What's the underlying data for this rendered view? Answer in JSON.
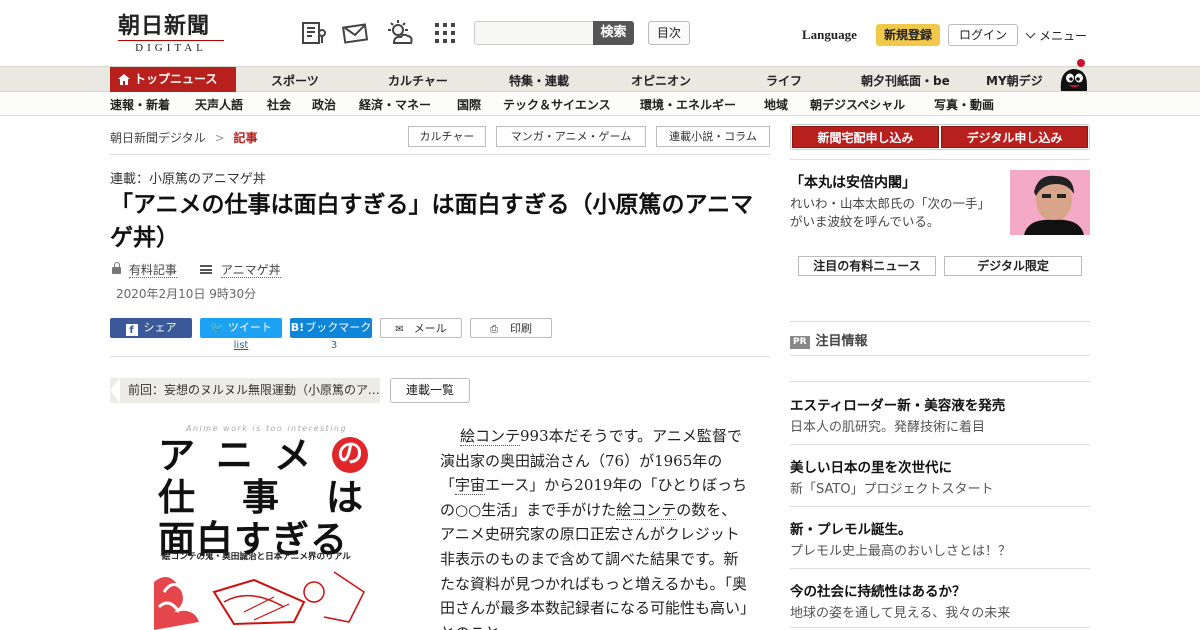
{
  "header": {
    "logo": {
      "main": "朝日新聞",
      "sub": "DIGITAL"
    },
    "icons": [
      "paper-icon",
      "mail-icon",
      "weather-icon",
      "grid-icon"
    ],
    "search": {
      "placeholder": "",
      "button": "検索"
    },
    "index_button": "目次",
    "language": "Language",
    "register": "新規登録",
    "login": "ログイン",
    "menu": "メニュー"
  },
  "nav_primary": [
    "トップニュース",
    "スポーツ",
    "カルチャー",
    "特集・連載",
    "オピニオン",
    "ライフ",
    "朝夕刊紙面・be",
    "MY朝デジ"
  ],
  "nav_secondary": [
    "速報・新着",
    "天声人語",
    "社会",
    "政治",
    "経済・マネー",
    "国際",
    "テック＆サイエンス",
    "環境・エネルギー",
    "地域",
    "朝デジスペシャル",
    "写真・動画"
  ],
  "breadcrumb": {
    "home": "朝日新聞デジタル",
    "sep": ">",
    "current": "記事"
  },
  "tags": [
    "カルチャー",
    "マンガ・アニメ・ゲーム",
    "連載小説・コラム"
  ],
  "article": {
    "series": "連載：小原篤のアニマゲ丼",
    "title": "「アニメの仕事は面白すぎる」は面白すぎる（小原篤のアニマゲ丼）",
    "paid": "有料記事",
    "series_link": "アニマゲ丼",
    "date": "2020年2月10日 9時30分",
    "share": {
      "facebook": "シェア",
      "twitter": "ツイート",
      "hatena": "ブックマーク",
      "mail": "メール",
      "print": "印刷",
      "twitter_count": "list",
      "hatena_count": "3"
    },
    "prev": "前回：妄想のヌルヌル無限運動（小原篤のアニマゲ丼）",
    "series_list": "連載一覧",
    "book": {
      "en": "Anime work is too interesting",
      "row1": [
        "ア",
        "ニ",
        "メ",
        "の"
      ],
      "row2": [
        "仕",
        "事",
        "は"
      ],
      "row3": "面白すぎる",
      "subtitle": "絵コンテの鬼・奥田誠治と日本アニメ界のリアル"
    },
    "body": {
      "kw1": "絵コンテ",
      "t1": "993本だそうです。アニメ監督で演出家の奥田誠治さん（76）が1965年の「",
      "kw2": "宇宙",
      "t2": "エース」から2019年の「ひとりぼっちの○○生活」まで手がけた",
      "kw3": "絵コンテ",
      "t3": "の数を、アニメ史研究家の原口正宏さんがクレジット非表示のものまで含めて調べた結果です。新たな資料が見つかればもっと増えるかも。「奥田さんが最多本数記録者になる可能性も高い」とのこと。"
    }
  },
  "sidebar": {
    "subscribe": [
      "新聞宅配申し込み",
      "デジタル申し込み"
    ],
    "feature": {
      "title": "「本丸は安倍内閣」",
      "desc": "れいわ・山本太郎氏の「次の一手」がいま波紋を呼んでいる。"
    },
    "tabs": [
      "注目の有料ニュース",
      "デジタル限定"
    ],
    "pr": {
      "badge": "PR",
      "heading": "注目情報"
    },
    "ads": [
      {
        "title": "エスティローダー新・美容液を発売",
        "desc": "日本人の肌研究。発酵技術に着目"
      },
      {
        "title": "美しい日本の里を次世代に",
        "desc": "新「SATO」プロジェクトスタート"
      },
      {
        "title": "新・プレモル誕生。",
        "desc": "プレモル史上最高のおいしさとは！？"
      },
      {
        "title": "今の社会に持続性はあるか？",
        "desc": "地球の姿を通して見える、我々の未来"
      }
    ]
  },
  "colors": {
    "brand_red": "#b8201e",
    "nav_bg": "#e9e8e1",
    "register_yellow": "#f1c94a",
    "facebook": "#3b5998",
    "twitter": "#1da1f2",
    "hatena": "#0d85d8"
  }
}
